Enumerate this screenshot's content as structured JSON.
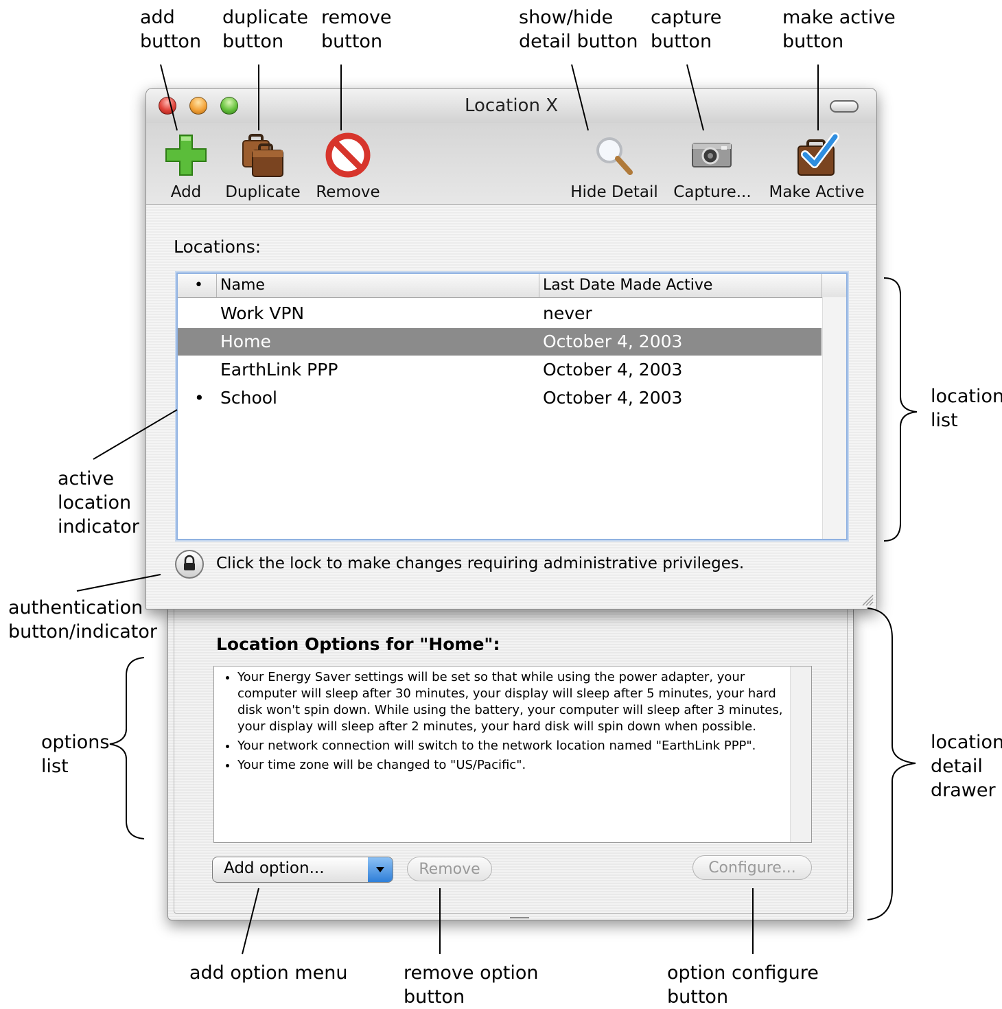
{
  "window": {
    "title": "Location X"
  },
  "toolbar": {
    "add_label": "Add",
    "duplicate_label": "Duplicate",
    "remove_label": "Remove",
    "hide_detail_label": "Hide Detail",
    "capture_label": "Capture...",
    "make_active_label": "Make Active"
  },
  "locations": {
    "section_label": "Locations:",
    "columns": {
      "active": "•",
      "name": "Name",
      "last_date": "Last Date Made Active"
    },
    "rows": [
      {
        "active": "",
        "name": "Work VPN",
        "date": "never",
        "selected": false
      },
      {
        "active": "",
        "name": "Home",
        "date": "October 4, 2003",
        "selected": true
      },
      {
        "active": "",
        "name": "EarthLink PPP",
        "date": "October 4, 2003",
        "selected": false
      },
      {
        "active": "•",
        "name": "School",
        "date": "October 4, 2003",
        "selected": false
      }
    ],
    "selection_color": "#8b8b8b"
  },
  "auth": {
    "lock_text": "Click the lock to make changes requiring administrative privileges."
  },
  "drawer": {
    "title": "Location Options for \"Home\":",
    "options": [
      "Your Energy Saver settings will be set so that while using the power adapter, your computer will sleep after 30 minutes, your display will sleep after 5 minutes, your hard disk won't spin down.  While using the battery, your computer will sleep after 3 minutes, your display will sleep after 2 minutes, your hard disk will spin down when possible.",
      "Your network connection will switch to the network location named \"EarthLink PPP\".",
      "Your time zone will be changed to \"US/Pacific\"."
    ],
    "add_option_label": "Add option...",
    "remove_label": "Remove",
    "configure_label": "Configure..."
  },
  "annotations": {
    "add_button": "add\nbutton",
    "duplicate_button": "duplicate\nbutton",
    "remove_button": "remove\nbutton",
    "show_hide_detail_button": "show/hide\ndetail button",
    "capture_button": "capture\nbutton",
    "make_active_button": "make active\nbutton",
    "location_list": "location\nlist",
    "active_location_indicator": "active\nlocation\nindicator",
    "authentication_indicator": "authentication\nbutton/indicator",
    "options_list": "options\nlist",
    "location_detail_drawer": "location\ndetail\ndrawer",
    "add_option_menu": "add option menu",
    "remove_option_button": "remove option\nbutton",
    "option_configure_button": "option configure\nbutton"
  },
  "icons": {
    "add": "plus-icon",
    "duplicate": "suitcases-icon",
    "remove": "prohibited-icon",
    "hide_detail": "magnifier-icon",
    "capture": "camera-icon",
    "make_active": "briefcase-check-icon",
    "lock": "lock-icon"
  }
}
